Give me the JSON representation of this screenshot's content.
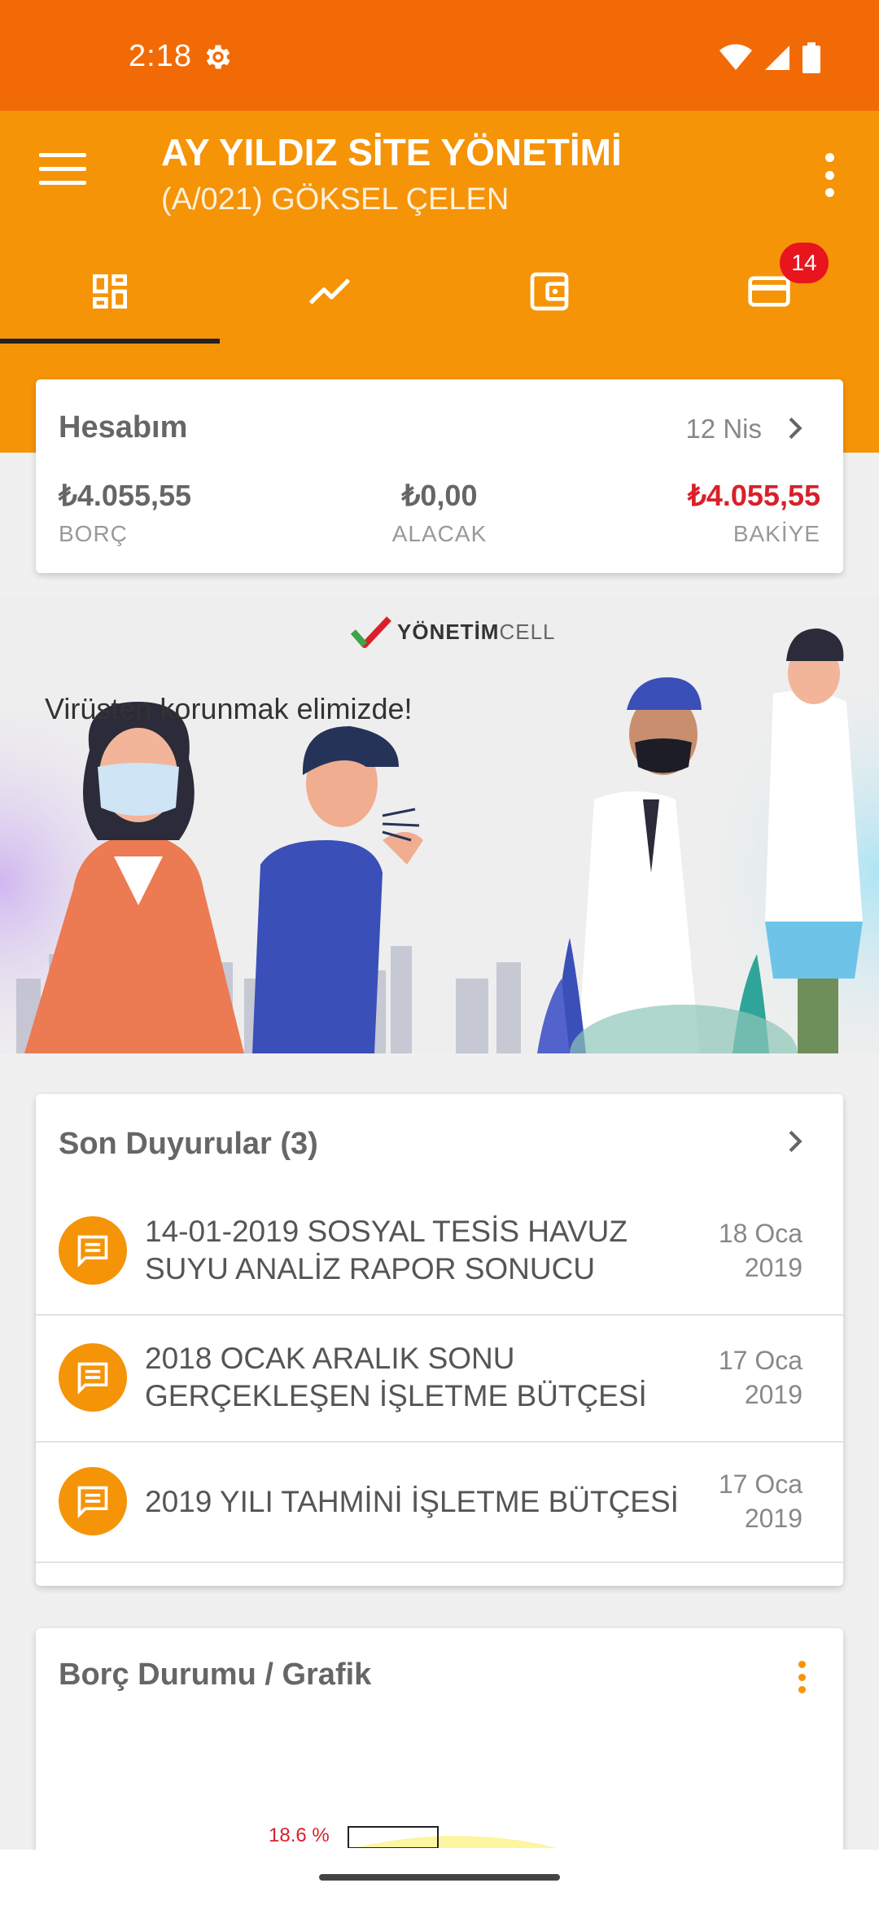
{
  "status_bar": {
    "time": "2:18"
  },
  "header": {
    "title": "AY YILDIZ SİTE YÖNETİMİ",
    "subtitle": "(A/021) GÖKSEL ÇELEN"
  },
  "tabs": [
    {
      "icon": "dashboard-icon"
    },
    {
      "icon": "trending-icon"
    },
    {
      "icon": "wallet-icon"
    },
    {
      "icon": "credit-card-icon",
      "badge": "14"
    }
  ],
  "account": {
    "title": "Hesabım",
    "date": "12 Nis",
    "debt_value": "₺4.055,55",
    "debt_label": "BORÇ",
    "credit_value": "₺0,00",
    "credit_label": "ALACAK",
    "balance_value": "₺4.055,55",
    "balance_label": "BAKİYE"
  },
  "banner": {
    "brand_main": "YÖNETİM",
    "brand_sub": "CELL",
    "headline": "Virüsten korunmak elimizde!"
  },
  "announcements": {
    "title": "Son Duyurular (3)",
    "items": [
      {
        "text": "14-01-2019 SOSYAL TESİS HAVUZ SUYU ANALİZ RAPOR SONUCU",
        "date_day": "18 Oca",
        "date_year": "2019"
      },
      {
        "text": "2018 OCAK  ARALIK SONU GERÇEKLEŞEN İŞLETME BÜTÇESİ",
        "date_day": "17 Oca",
        "date_year": "2019"
      },
      {
        "text": "2019 YILI TAHMİNİ İŞLETME BÜTÇESİ",
        "date_day": "17 Oca",
        "date_year": "2019"
      }
    ]
  },
  "chart_card": {
    "title": "Borç Durumu / Grafik",
    "peek_label": "18.6 %"
  },
  "colors": {
    "status_bar": "#f26a05",
    "app_bar": "#f59407",
    "badge": "#e8141e",
    "balance": "#d9202a"
  }
}
